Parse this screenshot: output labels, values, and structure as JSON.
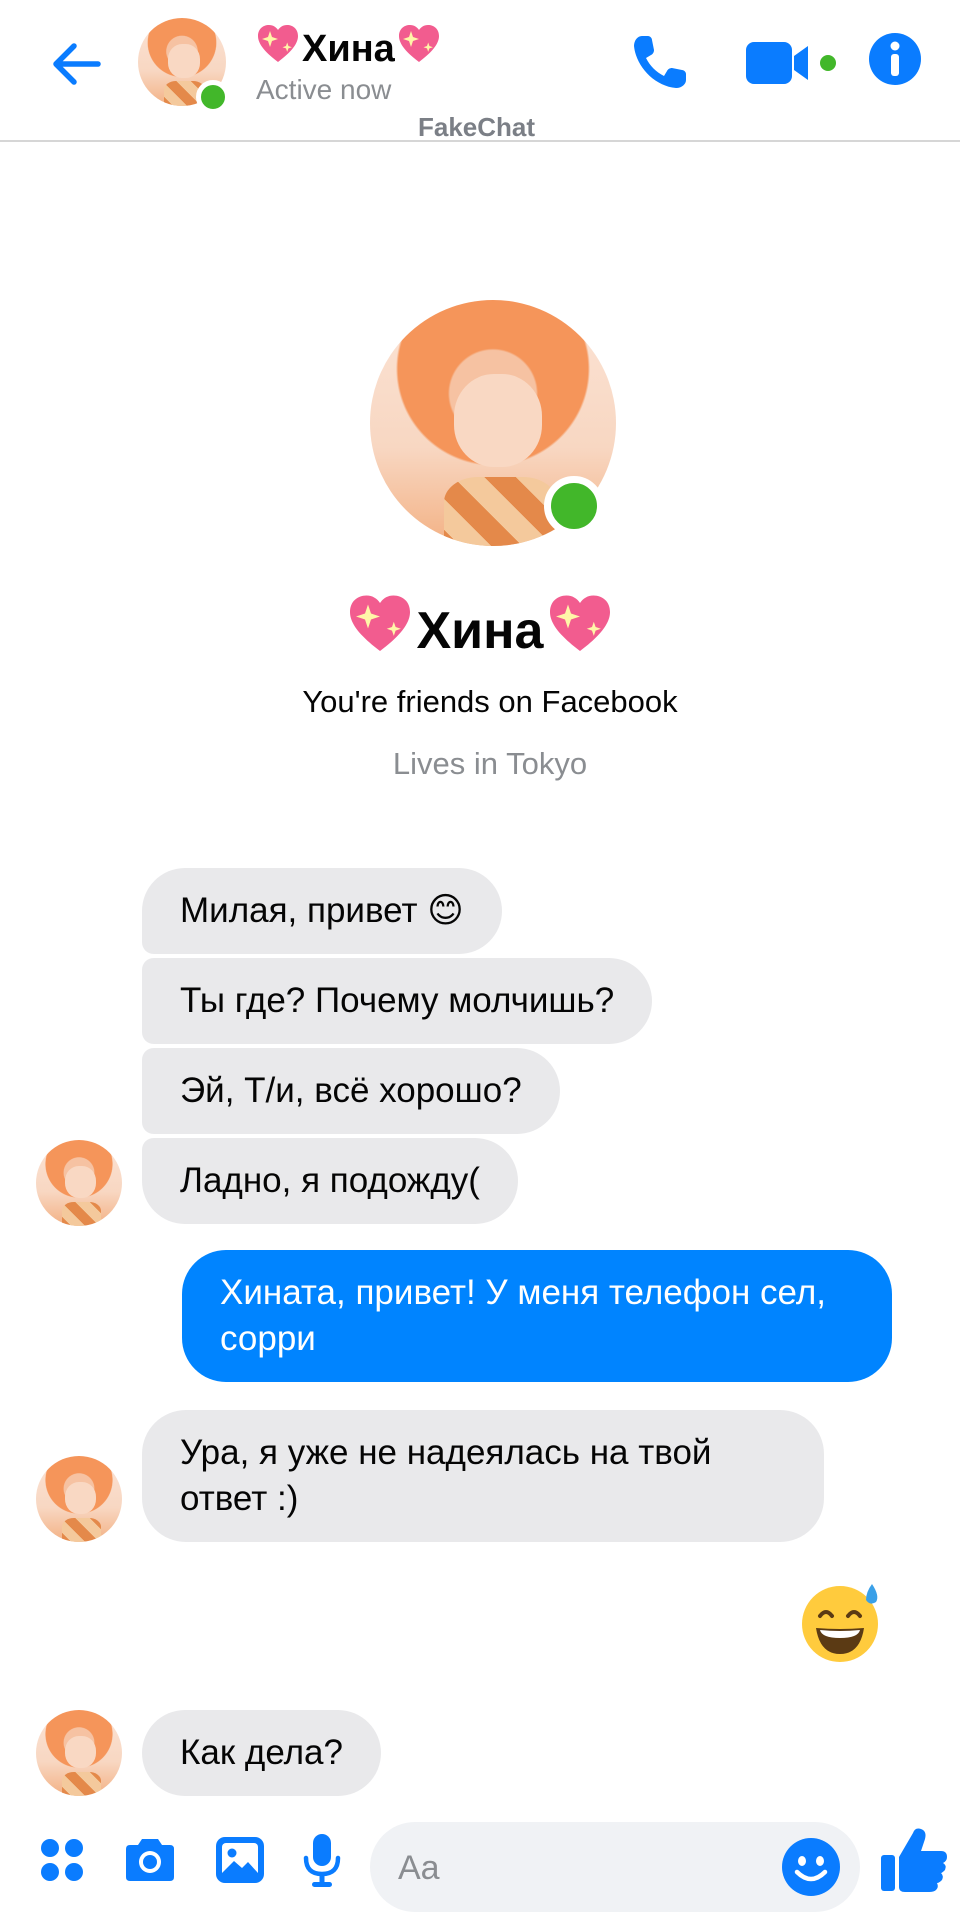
{
  "header": {
    "contact_name": "Хина",
    "status": "Active now",
    "watermark": "FakeChat"
  },
  "profile": {
    "name": "Хина",
    "friends_text": "You're friends on Facebook",
    "location": "Lives in Tokyo"
  },
  "messages": [
    {
      "from": "contact",
      "text": "Милая, привет 😊"
    },
    {
      "from": "contact",
      "text": "Ты где? Почему молчишь?"
    },
    {
      "from": "contact",
      "text": "Эй, Т/и, всё хорошо?"
    },
    {
      "from": "contact",
      "text": "Ладно, я подожду("
    },
    {
      "from": "me",
      "text": "Хината, привет! У меня телефон сел, сорри"
    },
    {
      "from": "contact",
      "text": "Ура, я уже не надеялась на твой ответ :)"
    },
    {
      "from": "me",
      "emoji": "😅"
    },
    {
      "from": "contact",
      "text": "Как дела?"
    }
  ],
  "composer": {
    "placeholder": "Aa"
  },
  "colors": {
    "accent": "#0084ff",
    "incoming_bubble": "#e9e9eb",
    "online": "#42b72a"
  },
  "icons": [
    "back-arrow-icon",
    "phone-icon",
    "video-camera-icon",
    "info-icon",
    "apps-icon",
    "camera-icon",
    "gallery-icon",
    "microphone-icon",
    "emoji-icon",
    "thumbs-up-icon",
    "sparkling-heart-icon"
  ]
}
